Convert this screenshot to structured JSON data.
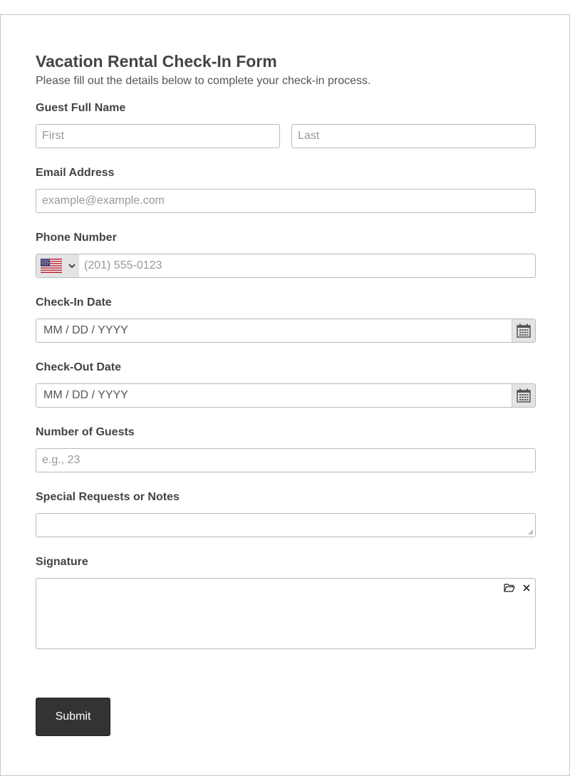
{
  "form": {
    "title": "Vacation Rental Check-In Form",
    "subtitle": "Please fill out the details below to complete your check-in process."
  },
  "guest_name": {
    "label": "Guest Full Name",
    "first_placeholder": "First",
    "last_placeholder": "Last"
  },
  "email": {
    "label": "Email Address",
    "placeholder": "example@example.com"
  },
  "phone": {
    "label": "Phone Number",
    "country_flag": "us-flag-icon",
    "placeholder": "(201) 555-0123"
  },
  "check_in": {
    "label": "Check-In Date",
    "placeholder": "MM / DD / YYYY"
  },
  "check_out": {
    "label": "Check-Out Date",
    "placeholder": "MM / DD / YYYY"
  },
  "guests": {
    "label": "Number of Guests",
    "placeholder": "e.g., 23"
  },
  "notes": {
    "label": "Special Requests or Notes",
    "value": ""
  },
  "signature": {
    "label": "Signature"
  },
  "submit": {
    "label": "Submit"
  },
  "colors": {
    "text": "#444444",
    "placeholder": "#999999",
    "border": "#b9b9b9",
    "button_bg": "#333333",
    "addon_bg": "#e4e4e4"
  }
}
